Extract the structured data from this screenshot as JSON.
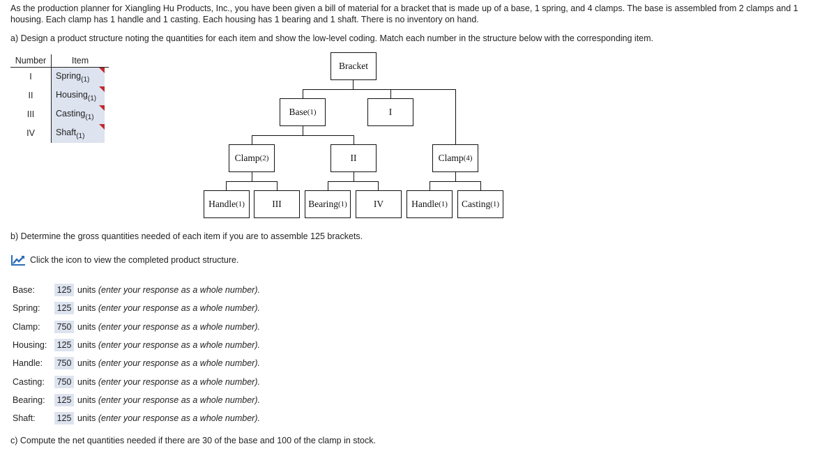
{
  "intro": "As the production planner for Xiangling Hu Products, Inc., you have been given a bill of material for a bracket that is made up of a base, 1 spring, and 4 clamps. The base is assembled from 2 clamps and 1 housing. Each clamp has 1 handle and 1 casting. Each housing has 1 bearing and 1 shaft. There is no inventory on hand.",
  "part_a": "a) Design a product structure noting the quantities for each item and show the low-level coding. Match each number in the structure below with the corresponding item.",
  "match_table": {
    "header_number": "Number",
    "header_item": "Item",
    "rows": [
      {
        "number": "I",
        "item": "Spring",
        "qty": "(1)"
      },
      {
        "number": "II",
        "item": "Housing",
        "qty": "(1)"
      },
      {
        "number": "III",
        "item": "Casting",
        "qty": "(1)"
      },
      {
        "number": "IV",
        "item": "Shaft",
        "qty": "(1)"
      }
    ]
  },
  "tree": {
    "bracket": {
      "label": "Bracket",
      "qty": ""
    },
    "base": {
      "label": "Base",
      "qty": "(1)"
    },
    "node_i": {
      "label": "I",
      "qty": ""
    },
    "clamp_left": {
      "label": "Clamp",
      "qty": "(2)"
    },
    "node_ii": {
      "label": "II",
      "qty": ""
    },
    "clamp_right": {
      "label": "Clamp",
      "qty": "(4)"
    },
    "handle_left": {
      "label": "Handle",
      "qty": "(1)"
    },
    "node_iii": {
      "label": "III",
      "qty": ""
    },
    "bearing": {
      "label": "Bearing",
      "qty": "(1)"
    },
    "node_iv": {
      "label": "IV",
      "qty": ""
    },
    "handle_right": {
      "label": "Handle",
      "qty": "(1)"
    },
    "casting_right": {
      "label": "Casting",
      "qty": "(1)"
    }
  },
  "part_b": "b) Determine the gross quantities needed of each item if you are to assemble 125 brackets.",
  "icon_text": "Click the icon to view the completed product structure.",
  "answers": [
    {
      "label": "Base:",
      "value": "125",
      "units": "units",
      "note": "(enter your response as a whole number)."
    },
    {
      "label": "Spring:",
      "value": "125",
      "units": "units",
      "note": "(enter your response as a whole number)."
    },
    {
      "label": "Clamp:",
      "value": "750",
      "units": "units",
      "note": "(enter your response as a whole number)."
    },
    {
      "label": "Housing:",
      "value": "125",
      "units": "units",
      "note": "(enter your response as a whole number)."
    },
    {
      "label": "Handle:",
      "value": "750",
      "units": "units",
      "note": "(enter your response as a whole number)."
    },
    {
      "label": "Casting:",
      "value": "750",
      "units": "units",
      "note": "(enter your response as a whole number)."
    },
    {
      "label": "Bearing:",
      "value": "125",
      "units": "units",
      "note": "(enter your response as a whole number)."
    },
    {
      "label": "Shaft:",
      "value": "125",
      "units": "units",
      "note": "(enter your response as a whole number)."
    }
  ],
  "part_c": "c) Compute the net quantities needed if there are 30 of the base and 100 of the clamp in stock.",
  "colors": {
    "answer_bg": "#dde3ef",
    "flag": "#c0282d",
    "icon_blue": "#2b6cb8"
  }
}
